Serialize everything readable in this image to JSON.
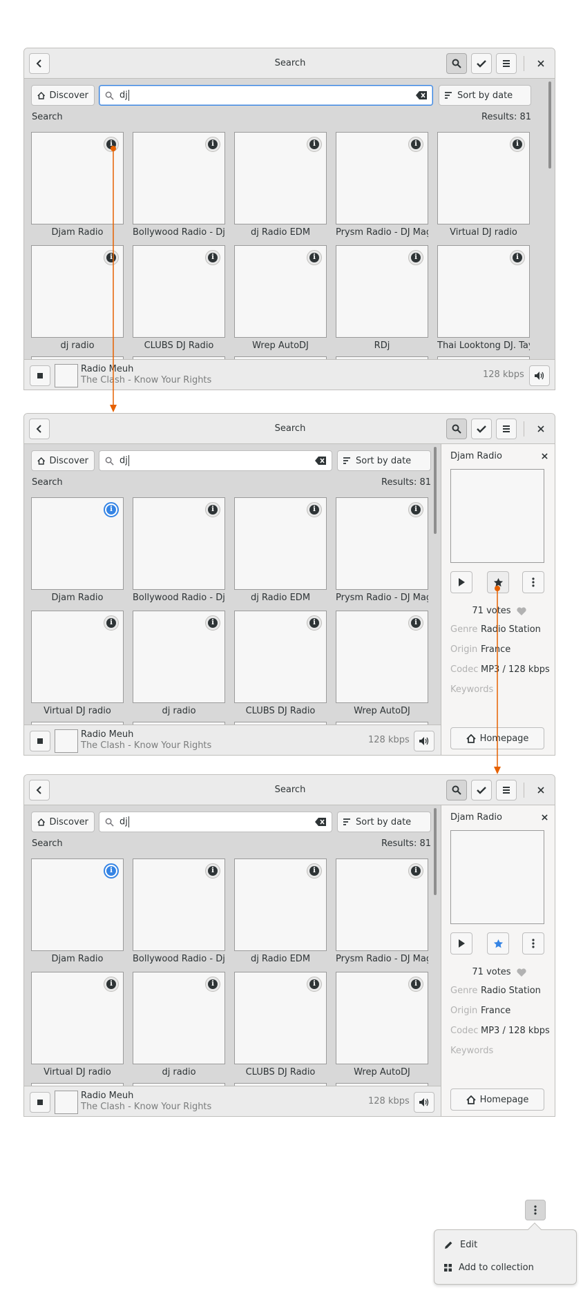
{
  "colors": {
    "accent": "#3584e4",
    "annotation": "#e66100",
    "window_bg": "#f6f5f4",
    "content_bg": "#d8d8d8"
  },
  "window": {
    "title": "Search"
  },
  "toolbar": {
    "discover_label": "Discover",
    "search_value": "dj",
    "sort_label": "Sort by date"
  },
  "section": {
    "label": "Search",
    "results": "Results: 81"
  },
  "stations": [
    "Djam Radio",
    "Bollywood Radio - Dj ...",
    "dj Radio EDM",
    "Prysm Radio - DJ Mag...",
    "Virtual DJ radio",
    "dj radio",
    "CLUBS DJ Radio",
    "Wrep AutoDJ",
    "RDj",
    "Thai Looktong DJ. Tay"
  ],
  "player": {
    "station": "Radio Meuh",
    "track": "The Clash - Know Your Rights",
    "bitrate": "128 kbps"
  },
  "details": {
    "name": "Djam Radio",
    "votes": "71 votes",
    "props": [
      {
        "key": "Genre",
        "value": "Radio Station"
      },
      {
        "key": "Origin",
        "value": "France"
      },
      {
        "key": "Codec",
        "value": "MP3 / 128 kbps"
      },
      {
        "key": "Keywords",
        "value": ""
      }
    ],
    "homepage_label": "Homepage"
  },
  "menu": {
    "items": [
      "Edit",
      "Add to collection"
    ]
  }
}
